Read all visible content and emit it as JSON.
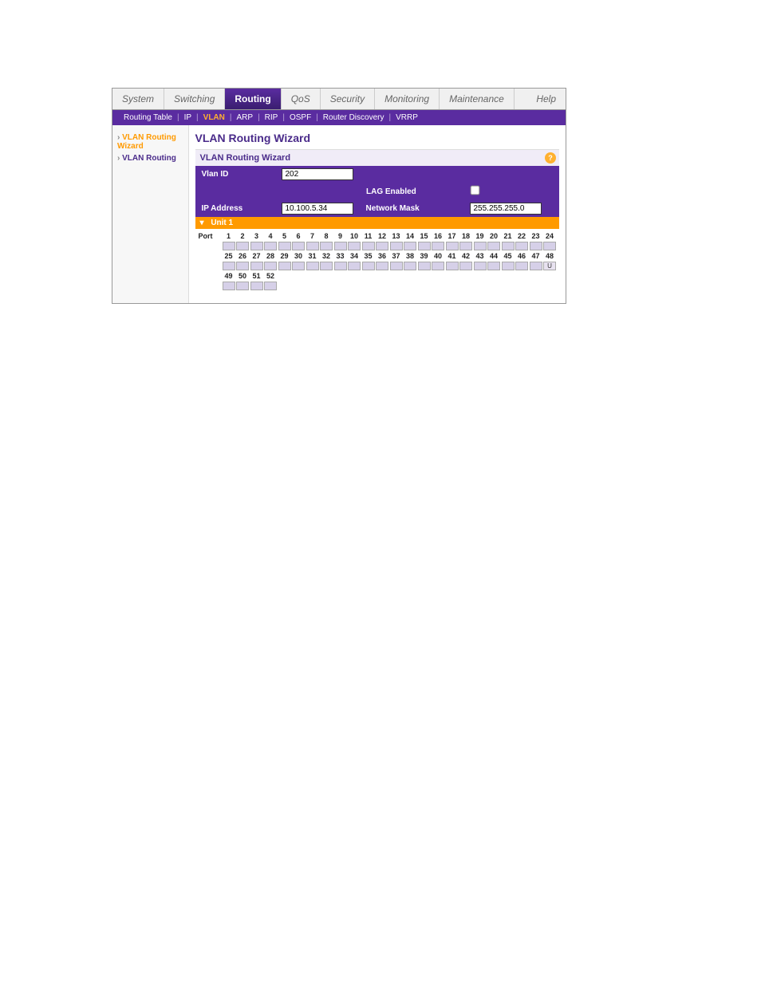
{
  "topnav": {
    "items": [
      "System",
      "Switching",
      "Routing",
      "QoS",
      "Security",
      "Monitoring",
      "Maintenance"
    ],
    "active_index": 2,
    "help": "Help"
  },
  "subnav": {
    "items": [
      "Routing Table",
      "IP",
      "VLAN",
      "ARP",
      "RIP",
      "OSPF",
      "Router Discovery",
      "VRRP"
    ],
    "active_index": 2
  },
  "sidebar": {
    "items": [
      {
        "label": "VLAN Routing Wizard",
        "active": true
      },
      {
        "label": "VLAN Routing",
        "active": false
      }
    ]
  },
  "page": {
    "title": "VLAN Routing Wizard",
    "panel_title": "VLAN Routing Wizard"
  },
  "form": {
    "vlan_id_label": "Vlan ID",
    "vlan_id_value": "202",
    "lag_label": "LAG Enabled",
    "lag_checked": false,
    "ip_label": "IP Address",
    "ip_value": "10.100.5.34",
    "nm_label": "Network Mask",
    "nm_value": "255.255.255.0"
  },
  "unit": {
    "label": "Unit 1"
  },
  "ports": {
    "row_label": "Port",
    "row1": [
      "1",
      "2",
      "3",
      "4",
      "5",
      "6",
      "7",
      "8",
      "9",
      "10",
      "11",
      "12",
      "13",
      "14",
      "15",
      "16",
      "17",
      "18",
      "19",
      "20",
      "21",
      "22",
      "23",
      "24"
    ],
    "row2": [
      "25",
      "26",
      "27",
      "28",
      "29",
      "30",
      "31",
      "32",
      "33",
      "34",
      "35",
      "36",
      "37",
      "38",
      "39",
      "40",
      "41",
      "42",
      "43",
      "44",
      "45",
      "46",
      "47",
      "48"
    ],
    "row3": [
      "49",
      "50",
      "51",
      "52"
    ],
    "marked_port_index_row2": 23,
    "mark_label": "U"
  }
}
